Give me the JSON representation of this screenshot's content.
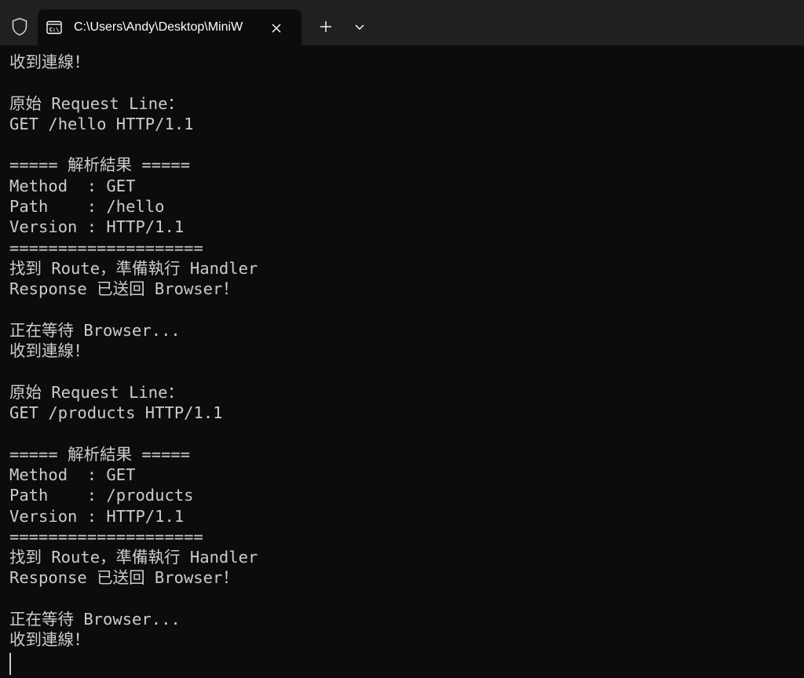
{
  "tab": {
    "title": "C:\\Users\\Andy\\Desktop\\MiniW"
  },
  "terminal": {
    "lines": [
      "收到連線！",
      "",
      "原始 Request Line：",
      "GET /hello HTTP/1.1",
      "",
      "===== 解析結果 =====",
      "Method  : GET",
      "Path    : /hello",
      "Version : HTTP/1.1",
      "====================",
      "找到 Route，準備執行 Handler",
      "Response 已送回 Browser！",
      "",
      "正在等待 Browser...",
      "收到連線！",
      "",
      "原始 Request Line：",
      "GET /products HTTP/1.1",
      "",
      "===== 解析結果 =====",
      "Method  : GET",
      "Path    : /products",
      "Version : HTTP/1.1",
      "====================",
      "找到 Route，準備執行 Handler",
      "Response 已送回 Browser！",
      "",
      "正在等待 Browser...",
      "收到連線！"
    ]
  },
  "colors": {
    "titlebar": "#202020",
    "background": "#0c0c0c",
    "text": "#cccccc"
  },
  "icons": {
    "shield": "shield-icon",
    "tab": "terminal-icon",
    "close": "close-icon",
    "newtab": "plus-icon",
    "dropdown": "chevron-down-icon"
  }
}
